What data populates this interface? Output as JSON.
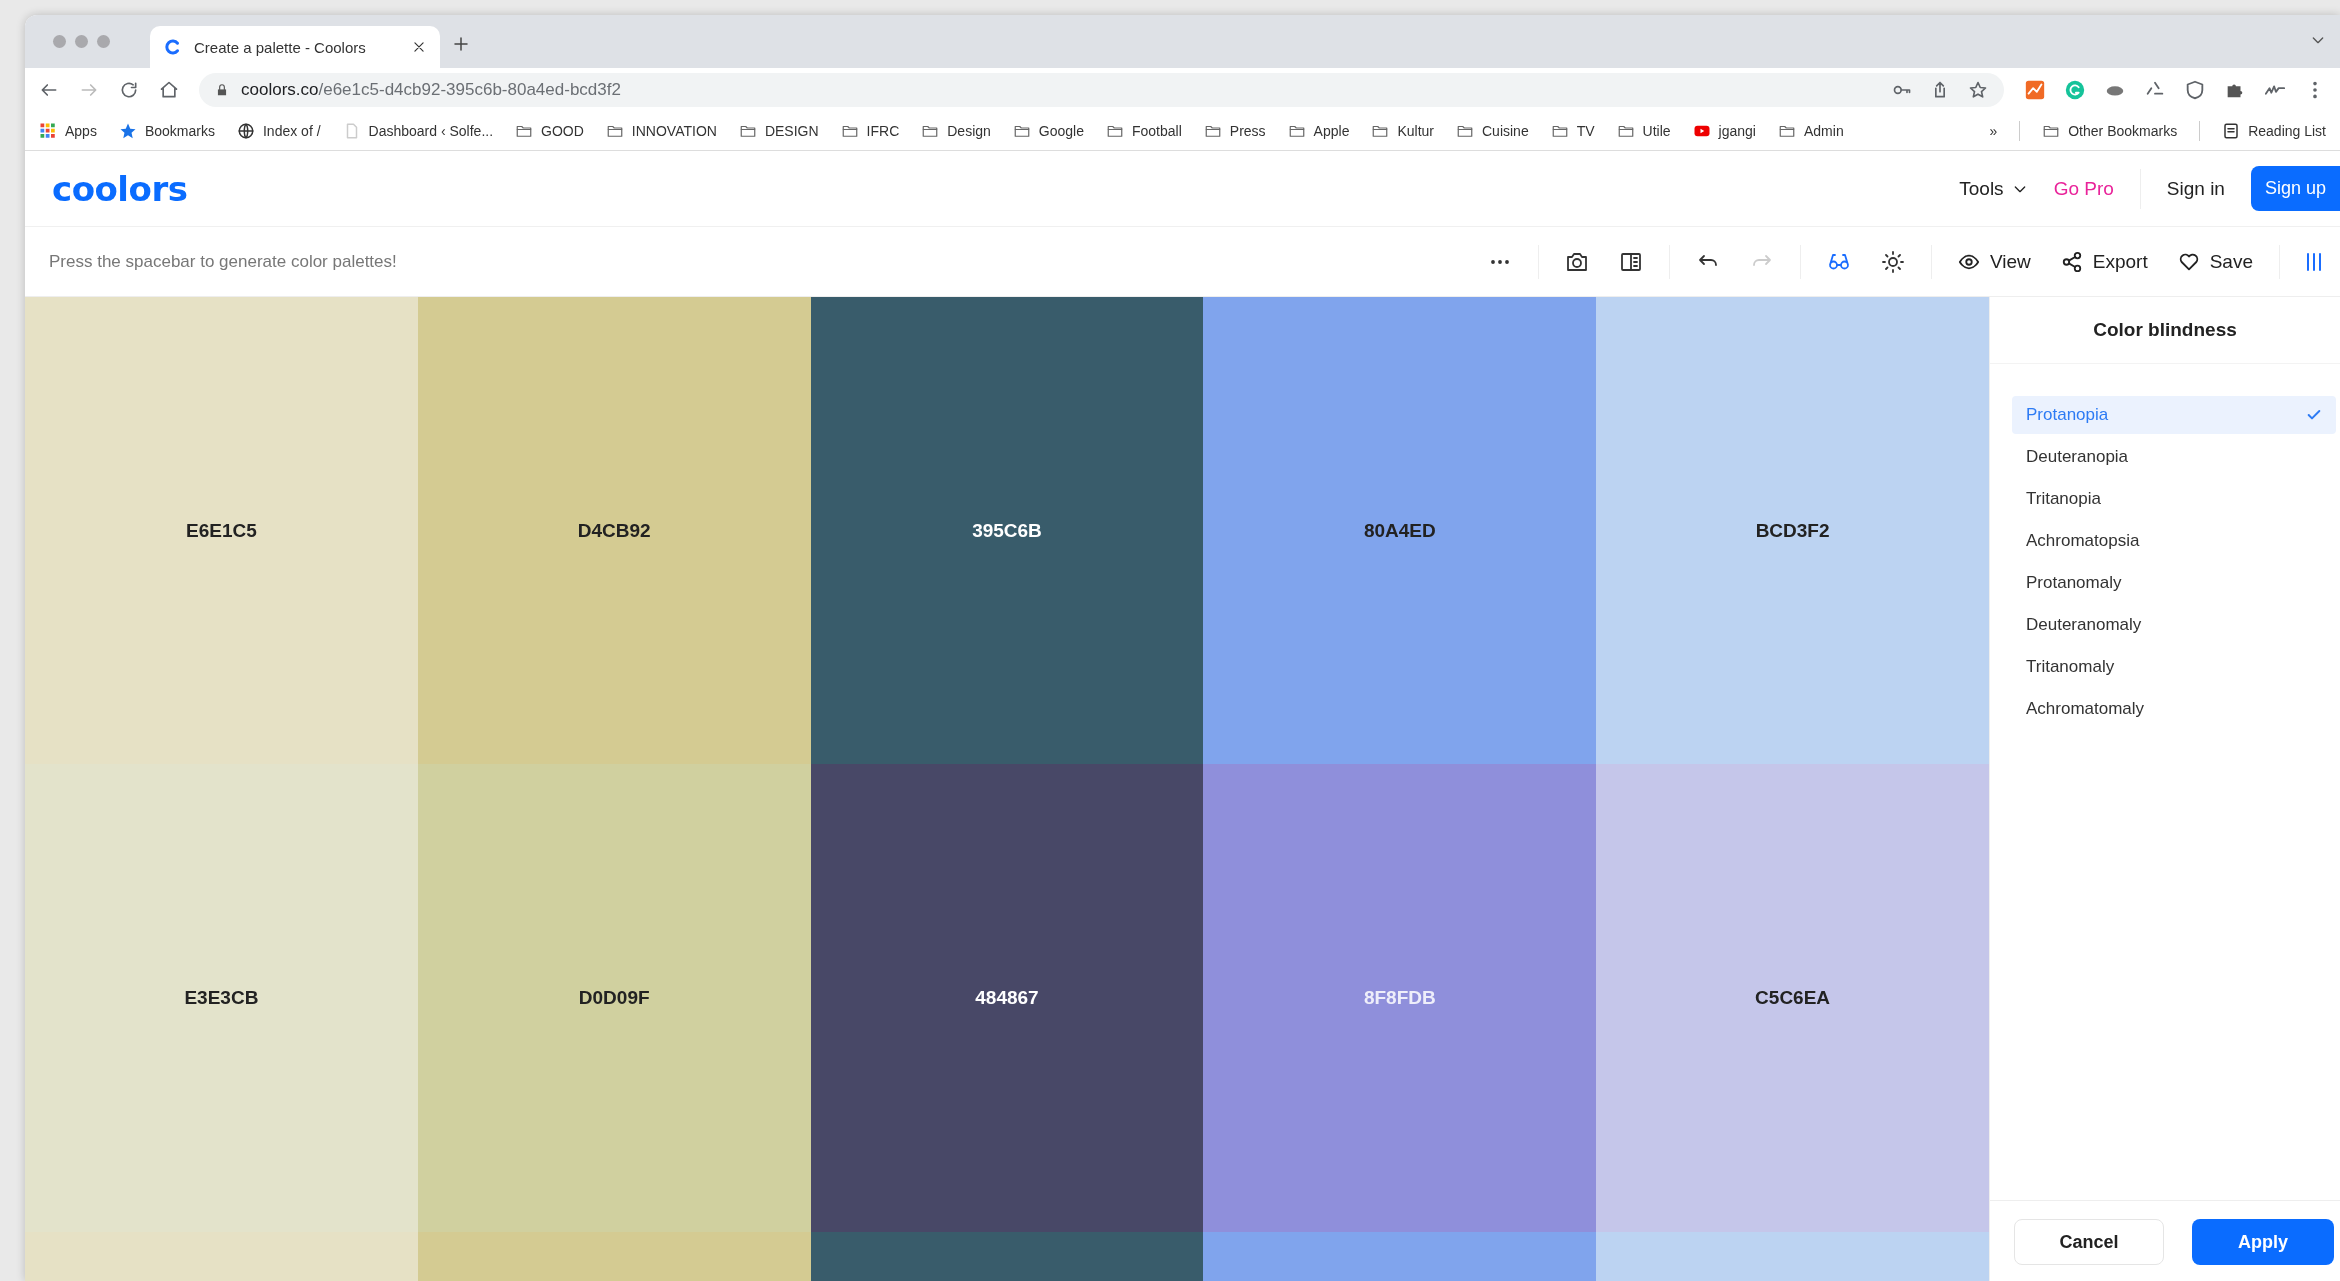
{
  "browser": {
    "tab": {
      "title": "Create a palette - Coolors"
    },
    "url": {
      "host": "coolors.co",
      "path": "/e6e1c5-d4cb92-395c6b-80a4ed-bcd3f2"
    },
    "bookmarks": [
      {
        "label": "Apps",
        "kind": "apps"
      },
      {
        "label": "Bookmarks",
        "kind": "star"
      },
      {
        "label": "Index of /",
        "kind": "globe"
      },
      {
        "label": "Dashboard ‹ Solfe...",
        "kind": "page"
      },
      {
        "label": "GOOD",
        "kind": "folder"
      },
      {
        "label": "INNOVATION",
        "kind": "folder"
      },
      {
        "label": "DESIGN",
        "kind": "folder"
      },
      {
        "label": "IFRC",
        "kind": "folder"
      },
      {
        "label": "Design",
        "kind": "folder"
      },
      {
        "label": "Google",
        "kind": "folder"
      },
      {
        "label": "Football",
        "kind": "folder"
      },
      {
        "label": "Press",
        "kind": "folder"
      },
      {
        "label": "Apple",
        "kind": "folder"
      },
      {
        "label": "Kultur",
        "kind": "folder"
      },
      {
        "label": "Cuisine",
        "kind": "folder"
      },
      {
        "label": "TV",
        "kind": "folder"
      },
      {
        "label": "Utile",
        "kind": "folder"
      },
      {
        "label": "jgangi",
        "kind": "youtube"
      },
      {
        "label": "Admin",
        "kind": "folder"
      }
    ],
    "overflow": "»",
    "other_bookmarks": "Other Bookmarks",
    "reading_list": "Reading List"
  },
  "header": {
    "logo": "coolors",
    "nav": [
      {
        "label": "Tools",
        "kind": "dropdown"
      },
      {
        "label": "Go Pro",
        "kind": "pro"
      },
      {
        "label": "Sign in",
        "kind": "link"
      },
      {
        "label": "Sign up",
        "kind": "primary"
      }
    ]
  },
  "toolbar": {
    "hint": "Press the spacebar to generate color palettes!",
    "tools": [
      {
        "kind": "more",
        "active": false,
        "disabled": false
      },
      {
        "kind": "camera",
        "active": false,
        "disabled": false
      },
      {
        "kind": "split",
        "active": false,
        "disabled": false
      },
      {
        "kind": "undo",
        "active": false,
        "disabled": false
      },
      {
        "kind": "redo",
        "active": false,
        "disabled": true
      },
      {
        "kind": "glasses",
        "active": true,
        "disabled": false
      },
      {
        "kind": "sun",
        "active": false,
        "disabled": false
      }
    ],
    "actions": [
      {
        "label": "View",
        "kind": "eye"
      },
      {
        "label": "Export",
        "kind": "share"
      },
      {
        "label": "Save",
        "kind": "heart"
      }
    ]
  },
  "palette": {
    "rows": [
      {
        "swatches": [
          {
            "hex": "E6E1C5",
            "color": "#e6e1c5"
          },
          {
            "hex": "D4CB92",
            "color": "#d4cb92"
          },
          {
            "hex": "395C6B",
            "color": "#395c6b"
          },
          {
            "hex": "80A4ED",
            "color": "#80a4ed"
          },
          {
            "hex": "BCD3F2",
            "color": "#bcd3f2"
          }
        ]
      },
      {
        "swatches": [
          {
            "hex": "E3E3CB",
            "color": "#e3e3cb"
          },
          {
            "hex": "D0D09F",
            "color": "#d0d09f"
          },
          {
            "hex": "484867",
            "color": "#484867"
          },
          {
            "hex": "8F8FDB",
            "color": "#8f8fdb"
          },
          {
            "hex": "C5C6EA",
            "color": "#c5c6ea"
          }
        ]
      },
      {
        "swatches": [
          {
            "color": "#e6e1c5"
          },
          {
            "color": "#d4cb92"
          },
          {
            "color": "#395c6b"
          },
          {
            "color": "#80a4ed"
          },
          {
            "color": "#bcd3f2"
          }
        ]
      }
    ]
  },
  "panel": {
    "title": "Color blindness",
    "options": [
      {
        "label": "Protanopia",
        "selected": true
      },
      {
        "label": "Deuteranopia",
        "selected": false
      },
      {
        "label": "Tritanopia",
        "selected": false
      },
      {
        "label": "Achromatopsia",
        "selected": false
      },
      {
        "label": "Protanomaly",
        "selected": false
      },
      {
        "label": "Deuteranomaly",
        "selected": false
      },
      {
        "label": "Tritanomaly",
        "selected": false
      },
      {
        "label": "Achromatomaly",
        "selected": false
      }
    ],
    "buttons": [
      {
        "label": "Cancel",
        "kind": "secondary"
      },
      {
        "label": "Apply",
        "kind": "primary"
      }
    ]
  }
}
